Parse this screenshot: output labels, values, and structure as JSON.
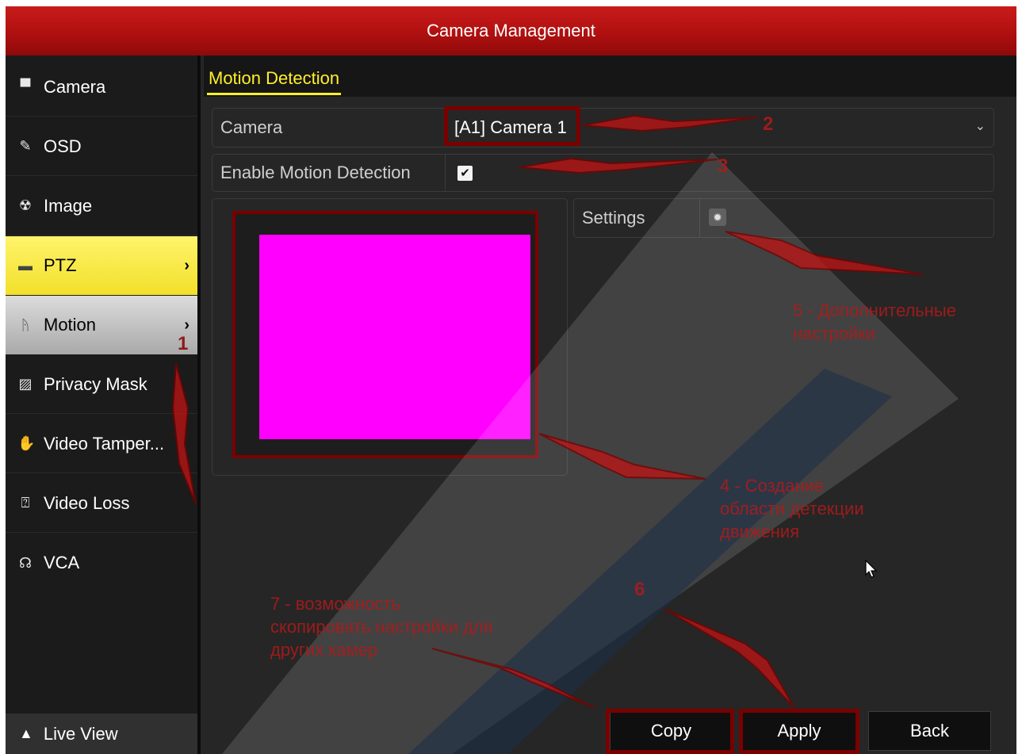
{
  "window": {
    "title": "Camera Management"
  },
  "sidebar": {
    "items": [
      {
        "label": "Camera",
        "icon": "camera-icon",
        "glyph": "📹"
      },
      {
        "label": "OSD",
        "icon": "osd-icon",
        "glyph": "✎"
      },
      {
        "label": "Image",
        "icon": "image-icon",
        "glyph": "☢"
      },
      {
        "label": "PTZ",
        "icon": "ptz-icon",
        "glyph": "▬",
        "chevron": "›"
      },
      {
        "label": "Motion",
        "icon": "motion-icon",
        "glyph": "🏃",
        "chevron": "›"
      },
      {
        "label": "Privacy Mask",
        "icon": "privacy-mask-icon",
        "glyph": "▨"
      },
      {
        "label": "Video Tamper...",
        "icon": "video-tamper-icon",
        "glyph": "✋"
      },
      {
        "label": "Video Loss",
        "icon": "video-loss-icon",
        "glyph": "⍰"
      },
      {
        "label": "VCA",
        "icon": "vca-icon",
        "glyph": "☊"
      }
    ],
    "live_view": {
      "label": "Live View",
      "icon": "home-icon",
      "glyph": "⌂"
    }
  },
  "tabs": {
    "active": "Motion Detection"
  },
  "form": {
    "camera_label": "Camera",
    "camera_value": "[A1] Camera 1",
    "enable_label": "Enable Motion Detection",
    "enable_checked": true,
    "settings_label": "Settings"
  },
  "buttons": {
    "copy": "Copy",
    "apply": "Apply",
    "back": "Back"
  },
  "annotations": {
    "n1": "1",
    "n2": "2",
    "n3": "3",
    "n4": "4 - Создание",
    "n4b": "области детекции",
    "n4c": "движения",
    "n5": "5 - Дополнительные",
    "n5b": "настройки",
    "n6": "6",
    "n7": "7 - возможность",
    "n7b": "скопировать настройки для",
    "n7c": "других камер"
  },
  "colors": {
    "title_bar": "#b01010",
    "active_tab": "#ffef2a",
    "ptz_highlight": "#f2e02a",
    "motion_area": "#ff00ff",
    "annotation": "#b21a1a"
  }
}
